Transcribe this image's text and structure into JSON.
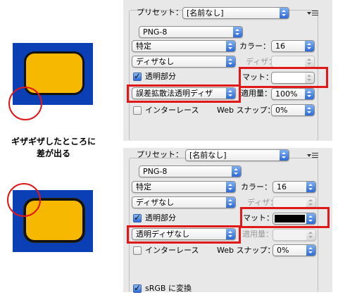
{
  "caption": {
    "line1": "ギザギザしたところに",
    "line2": "差が出る"
  },
  "colors": {
    "sample_bg": "#0a3fb5",
    "shape_fill": "#f6b800",
    "highlight": "#e01818",
    "matte_black": "#000000"
  },
  "panel_top": {
    "preset_label": "プリセット：",
    "preset_value": "[名前なし]",
    "format_value": "PNG-8",
    "reduction_value": "特定",
    "colors_label": "カラー：",
    "colors_value": "16",
    "dither_select_value": "ディザなし",
    "dither_label": "ディザ：",
    "transparency_label": "透明部分",
    "transparency_checked": true,
    "matte_label": "マット：",
    "matte_value": "白",
    "transparency_dither_value": "誤差拡散法透明ディザ",
    "amount_label": "適用量：",
    "amount_value": "100%",
    "interlace_label": "インターレース",
    "interlace_checked": false,
    "websnap_label": "Web スナップ：",
    "websnap_value": "0%"
  },
  "panel_bottom": {
    "preset_label": "プリセット：",
    "preset_value": "[名前なし]",
    "format_value": "PNG-8",
    "reduction_value": "特定",
    "colors_label": "カラー：",
    "colors_value": "16",
    "dither_select_value": "ディザなし",
    "dither_label": "ディザ：",
    "transparency_label": "透明部分",
    "transparency_checked": true,
    "matte_label": "マット：",
    "matte_value": "黒",
    "transparency_dither_value": "透明ディザなし",
    "amount_label": "適用量：",
    "amount_value": "",
    "interlace_label": "インターレース",
    "interlace_checked": false,
    "websnap_label": "Web スナップ：",
    "websnap_value": "0%",
    "srgb_label": "sRGB に変換",
    "srgb_checked": true
  }
}
